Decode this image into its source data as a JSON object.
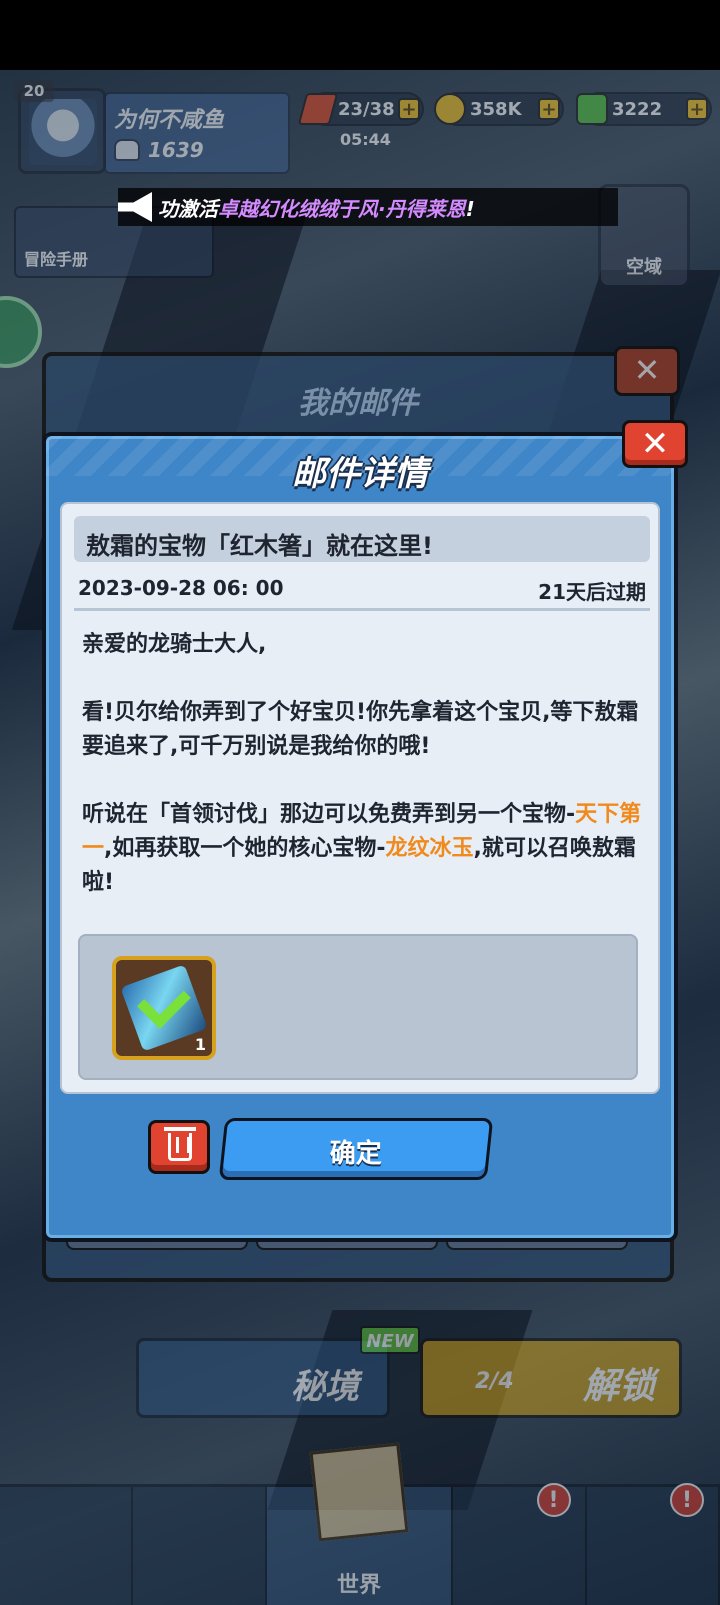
{
  "player": {
    "level": "20",
    "name": "为何不咸鱼",
    "power": "1639"
  },
  "resources": {
    "energy": "23/38",
    "energy_timer": "05:44",
    "gold": "358K",
    "gems": "3222",
    "plus": "+"
  },
  "announcement": {
    "prefix": "功激活",
    "highlight": "卓越幻化绒绒于风·丹得莱恩",
    "suffix": "!"
  },
  "hud": {
    "adventure_book": "冒险手册",
    "sky_domain": "空域",
    "mail_panel_title": "我的邮件",
    "secret_realm": "秘境",
    "new_badge": "NEW",
    "unlock": "解锁",
    "unlock_progress": "2/4",
    "nav_world": "世界",
    "alert": "!"
  },
  "dialog": {
    "title": "邮件详情",
    "close_symbol": "✕",
    "subject": "敖霜的宝物「红木箸」就在这里!",
    "date": "2023-09-28 06: 00",
    "expires": "21天后过期",
    "greeting": "亲爱的龙骑士大人,",
    "paragraph2": "看!贝尔给你弄到了个好宝贝!你先拿着这个宝贝,等下敖霜要追来了,可千万别说是我给你的哦!",
    "paragraph3_a": "听说在「首领讨伐」那边可以免费弄到另一个宝物-",
    "paragraph3_hl1": "天下第一",
    "paragraph3_b": ",如再获取一个她的核心宝物-",
    "paragraph3_hl2": "龙纹冰玉",
    "paragraph3_c": ",就可以召唤敖霜啦!",
    "reward_count": "1",
    "confirm_label": "确定"
  },
  "colors": {
    "dialog_bg": "#3f86c8",
    "highlight_text": "#f08a1c",
    "confirm_button": "#3c9cf2",
    "delete_button": "#e0432f",
    "item_frame": "#d6a21d"
  }
}
